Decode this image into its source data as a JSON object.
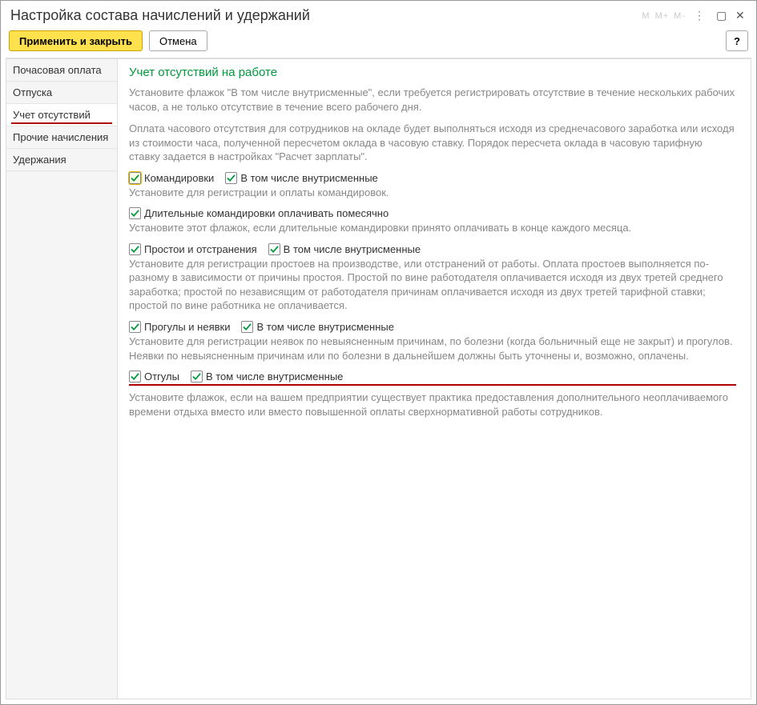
{
  "window": {
    "title": "Настройка состава начислений и удержаний",
    "mem_labels": [
      "M",
      "M+",
      "M-"
    ]
  },
  "toolbar": {
    "apply_close": "Применить и закрыть",
    "cancel": "Отмена",
    "help": "?"
  },
  "sidebar": {
    "items": [
      {
        "label": "Почасовая оплата"
      },
      {
        "label": "Отпуска"
      },
      {
        "label": "Учет отсутствий"
      },
      {
        "label": "Прочие начисления"
      },
      {
        "label": "Удержания"
      }
    ],
    "active_index": 2
  },
  "content": {
    "title": "Учет отсутствий на работе",
    "intro1": "Установите флажок \"В том числе внутрисменные\", если требуется регистрировать отсутствие в течение нескольких рабочих часов, а не только отсутствие в течение всего рабочего дня.",
    "intro2": "Оплата часового отсутствия для сотрудников на окладе будет выполняться исходя из среднечасового заработка или исходя из стоимости часа, полученной пересчетом оклада в часовую ставку. Порядок пересчета оклада в часовую тарифную ставку задается в настройках \"Расчет зарплаты\".",
    "ck": {
      "trips": "Командировки",
      "intrashift": "В том числе внутрисменные",
      "trips_desc": "Установите для регистрации и оплаты командировок.",
      "long_trips": "Длительные командировки оплачивать помесячно",
      "long_trips_desc": "Установите этот флажок, если длительные командировки принято оплачивать в конце каждого месяца.",
      "downtime": "Простои и отстранения",
      "downtime_desc": "Установите для регистрации простоев на производстве, или отстранений от работы. Оплата простоев выполняется по-разному в зависимости от причины простоя. Простой по вине работодателя оплачивается исходя из двух третей среднего заработка; простой по независящим от работодателя причинам оплачивается исходя из двух третей тарифной ставки; простой по вине работника не оплачивается.",
      "absences": "Прогулы и неявки",
      "absences_desc": "Установите для регистрации неявок по невыясненным причинам, по болезни (когда больничный еще не закрыт) и прогулов. Неявки по невыясненным причинам или по болезни в дальнейшем должны быть уточнены и, возможно, оплачены.",
      "compoff": "Отгулы",
      "compoff_desc": "Установите флажок, если на вашем предприятии существует практика предоставления дополнительного неоплачиваемого времени отдыха вместо или вместо повышенной оплаты сверхнормативной работы сотрудников."
    }
  }
}
